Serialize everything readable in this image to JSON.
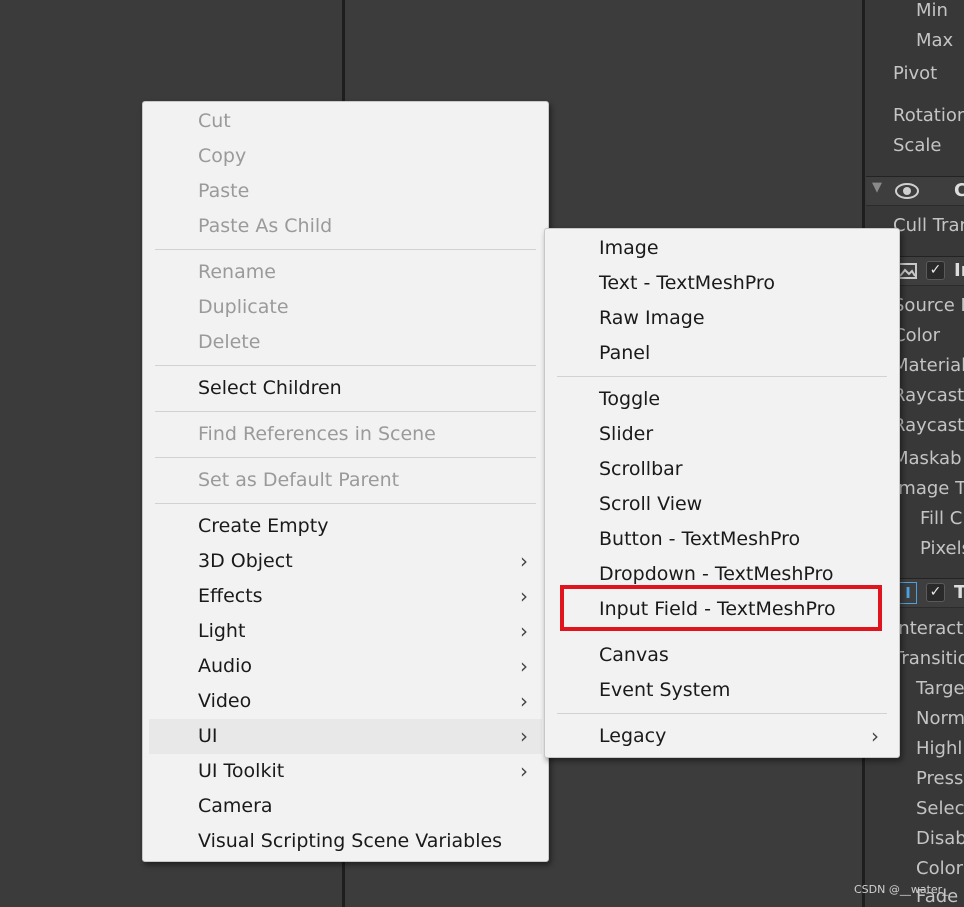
{
  "context_menu": {
    "items": [
      {
        "label": "Cut",
        "enabled": false
      },
      {
        "label": "Copy",
        "enabled": false
      },
      {
        "label": "Paste",
        "enabled": false
      },
      {
        "label": "Paste As Child",
        "enabled": false
      },
      {
        "label": "Rename",
        "enabled": false
      },
      {
        "label": "Duplicate",
        "enabled": false
      },
      {
        "label": "Delete",
        "enabled": false
      },
      {
        "label": "Select Children",
        "enabled": true
      },
      {
        "label": "Find References in Scene",
        "enabled": false
      },
      {
        "label": "Set as Default Parent",
        "enabled": false
      },
      {
        "label": "Create Empty",
        "enabled": true
      },
      {
        "label": "3D Object",
        "enabled": true,
        "submenu": true
      },
      {
        "label": "Effects",
        "enabled": true,
        "submenu": true
      },
      {
        "label": "Light",
        "enabled": true,
        "submenu": true
      },
      {
        "label": "Audio",
        "enabled": true,
        "submenu": true
      },
      {
        "label": "Video",
        "enabled": true,
        "submenu": true
      },
      {
        "label": "UI",
        "enabled": true,
        "submenu": true,
        "highlighted": true
      },
      {
        "label": "UI Toolkit",
        "enabled": true,
        "submenu": true
      },
      {
        "label": "Camera",
        "enabled": true
      },
      {
        "label": "Visual Scripting Scene Variables",
        "enabled": true
      }
    ]
  },
  "ui_submenu": {
    "items": [
      {
        "label": "Image"
      },
      {
        "label": "Text - TextMeshPro"
      },
      {
        "label": "Raw Image"
      },
      {
        "label": "Panel"
      },
      {
        "label": "Toggle"
      },
      {
        "label": "Slider"
      },
      {
        "label": "Scrollbar"
      },
      {
        "label": "Scroll View"
      },
      {
        "label": "Button - TextMeshPro"
      },
      {
        "label": "Dropdown - TextMeshPro"
      },
      {
        "label": "Input Field - TextMeshPro",
        "annotated": true
      },
      {
        "label": "Canvas"
      },
      {
        "label": "Event System"
      },
      {
        "label": "Legacy",
        "submenu": true
      }
    ],
    "annotation_color": "#e0141c"
  },
  "inspector": {
    "rows": [
      "Min",
      "Max",
      "Pivot",
      "Rotation",
      "Scale",
      "C",
      "Cull Tran",
      "In",
      "Source I",
      "Color",
      "Material",
      "Raycast",
      "Raycast",
      "Maskab",
      "Image T",
      "Fill C",
      "Pixels",
      "T",
      "Interacta",
      "Transitio",
      "Targe",
      "Norma",
      "Highli",
      "Press",
      "Selec",
      "Disab",
      "Color",
      "Fade"
    ]
  },
  "icons": {
    "chevron": "›",
    "check": "✓",
    "eye": "eye-icon",
    "image": "image-icon",
    "text_cursor": "I"
  },
  "watermark": "CSDN @__water_"
}
